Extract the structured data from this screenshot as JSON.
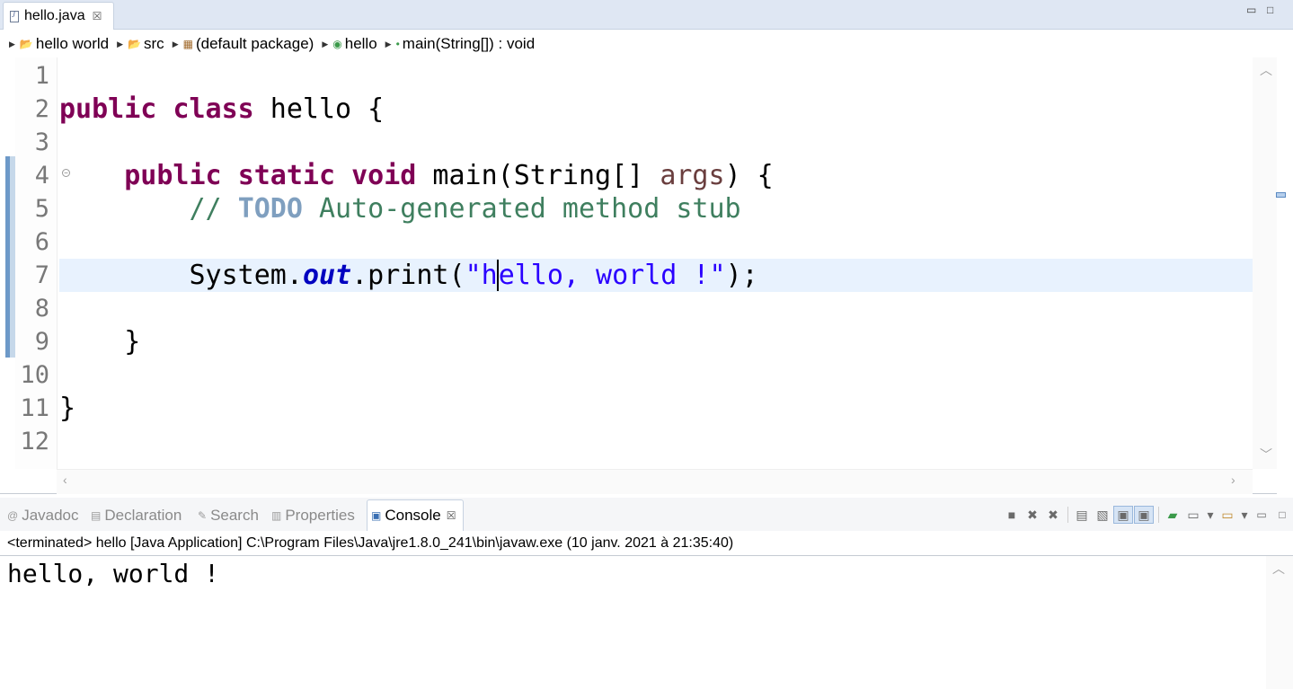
{
  "editor_tab": {
    "label": "hello.java",
    "close": "☒"
  },
  "window_controls": {
    "minimize": "▭",
    "maximize": "□"
  },
  "breadcrumb": [
    {
      "icon": "project-icon",
      "glyph": "📂",
      "label": "hello world"
    },
    {
      "icon": "source-folder-icon",
      "glyph": "📂",
      "label": "src"
    },
    {
      "icon": "package-icon",
      "glyph": "▦",
      "label": "(default package)"
    },
    {
      "icon": "class-icon",
      "glyph": "◉",
      "label": "hello"
    },
    {
      "icon": "method-icon",
      "glyph": "•",
      "label": "main(String[]) : void"
    }
  ],
  "editor": {
    "line_numbers": [
      "1",
      "2",
      "3",
      "4",
      "5",
      "6",
      "7",
      "8",
      "9",
      "10",
      "11",
      "12"
    ],
    "current_line": 7,
    "code": {
      "l2_kw1": "public",
      "l2_kw2": "class",
      "l2_rest": " hello {",
      "l4_indent": "    ",
      "l4_kw1": "public",
      "l4_kw2": "static",
      "l4_kw3": "void",
      "l4_mid": " main(String[] ",
      "l4_param": "args",
      "l4_end": ") {",
      "l5_indent": "        ",
      "l5_comment1": "// ",
      "l5_task": "TODO",
      "l5_comment2": " Auto-generated method stub",
      "l7_indent": "        ",
      "l7_pre": "System.",
      "l7_field": "out",
      "l7_mid": ".print(",
      "l7_str1": "\"h",
      "l7_str2": "ello, world !\"",
      "l7_end": ");",
      "l9_text": "    }",
      "l11_text": "}"
    }
  },
  "views": {
    "tabs": [
      {
        "name": "tab-javadoc",
        "glyph": "@",
        "label": "Javadoc"
      },
      {
        "name": "tab-declaration",
        "glyph": "▤",
        "label": "Declaration"
      },
      {
        "name": "tab-search",
        "glyph": "✎",
        "label": "Search"
      },
      {
        "name": "tab-properties",
        "glyph": "▥",
        "label": "Properties"
      },
      {
        "name": "tab-console",
        "glyph": "▣",
        "label": "Console",
        "close": "☒"
      }
    ],
    "toolbar_glyphs": {
      "terminate": "■",
      "remove_launch": "✖",
      "remove_all": "✖",
      "scroll_lock": "▤",
      "word_wrap": "▧",
      "show_on_stdout": "▣",
      "show_on_stderr": "▣",
      "pin": "▰",
      "display_console": "▭",
      "open_console": "▭",
      "dropdown": "▾"
    }
  },
  "console": {
    "status": "<terminated> hello [Java Application] C:\\Program Files\\Java\\jre1.8.0_241\\bin\\javaw.exe (10 janv. 2021 à 21:35:40)",
    "output": "hello, world !"
  },
  "colors": {
    "keyword": "#7f0055",
    "comment": "#3f7f5f",
    "task_tag": "#7f9fbf",
    "string": "#2a00ff",
    "static_field": "#0000c0",
    "current_line_highlight": "#e8f2fe"
  }
}
